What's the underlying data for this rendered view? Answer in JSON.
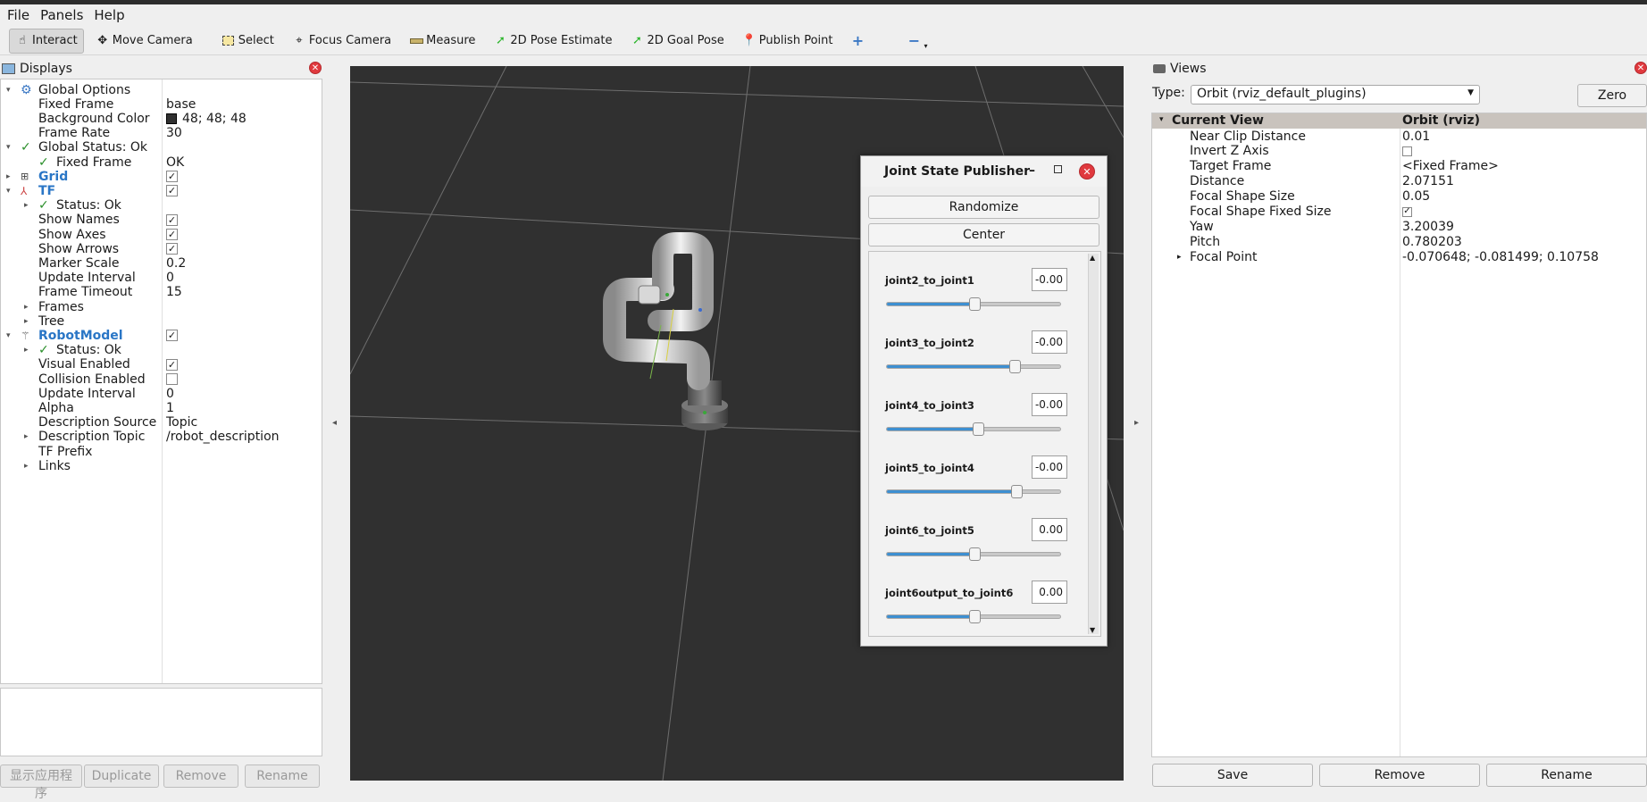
{
  "menu": [
    "File",
    "Panels",
    "Help"
  ],
  "toolbar": {
    "interact": "Interact",
    "move_camera": "Move Camera",
    "select": "Select",
    "focus_camera": "Focus Camera",
    "measure": "Measure",
    "pose_estimate": "2D Pose Estimate",
    "goal_pose": "2D Goal Pose",
    "publish_point": "Publish Point"
  },
  "displays": {
    "title": "Displays",
    "rows": [
      {
        "label": "Global Options",
        "value": ""
      },
      {
        "label": "Fixed Frame",
        "value": "base"
      },
      {
        "label": "Background Color",
        "value": "48; 48; 48"
      },
      {
        "label": "Frame Rate",
        "value": "30"
      },
      {
        "label": "Global Status: Ok",
        "value": ""
      },
      {
        "label": "Fixed Frame",
        "value": "OK"
      },
      {
        "label": "Grid",
        "value": ""
      },
      {
        "label": "TF",
        "value": ""
      },
      {
        "label": "Status: Ok",
        "value": ""
      },
      {
        "label": "Show Names",
        "value": ""
      },
      {
        "label": "Show Axes",
        "value": ""
      },
      {
        "label": "Show Arrows",
        "value": ""
      },
      {
        "label": "Marker Scale",
        "value": "0.2"
      },
      {
        "label": "Update Interval",
        "value": "0"
      },
      {
        "label": "Frame Timeout",
        "value": "15"
      },
      {
        "label": "Frames",
        "value": ""
      },
      {
        "label": "Tree",
        "value": ""
      },
      {
        "label": "RobotModel",
        "value": ""
      },
      {
        "label": "Status: Ok",
        "value": ""
      },
      {
        "label": "Visual Enabled",
        "value": ""
      },
      {
        "label": "Collision Enabled",
        "value": ""
      },
      {
        "label": "Update Interval",
        "value": "0"
      },
      {
        "label": "Alpha",
        "value": "1"
      },
      {
        "label": "Description Source",
        "value": "Topic"
      },
      {
        "label": "Description Topic",
        "value": "/robot_description"
      },
      {
        "label": "TF Prefix",
        "value": ""
      },
      {
        "label": "Links",
        "value": ""
      }
    ],
    "buttons": {
      "add": "显示应用程序",
      "duplicate": "Duplicate",
      "remove": "Remove",
      "rename": "Rename"
    }
  },
  "jsp": {
    "title": "Joint State Publisher",
    "randomize": "Randomize",
    "center": "Center",
    "joints": [
      {
        "name": "joint2_to_joint1",
        "value": "-0.00",
        "position": 0.5
      },
      {
        "name": "joint3_to_joint2",
        "value": "-0.00",
        "position": 0.73
      },
      {
        "name": "joint4_to_joint3",
        "value": "-0.00",
        "position": 0.52
      },
      {
        "name": "joint5_to_joint4",
        "value": "-0.00",
        "position": 0.74
      },
      {
        "name": "joint6_to_joint5",
        "value": "0.00",
        "position": 0.5
      },
      {
        "name": "joint6output_to_joint6",
        "value": "0.00",
        "position": 0.5
      }
    ]
  },
  "views": {
    "title": "Views",
    "type_label": "Type:",
    "type_value": "Orbit (rviz_default_plugins)",
    "zero": "Zero",
    "header_key": "Current View",
    "header_value": "Orbit (rviz)",
    "props": [
      {
        "key": "Near Clip Distance",
        "value": "0.01"
      },
      {
        "key": "Invert Z Axis",
        "value": ""
      },
      {
        "key": "Target Frame",
        "value": "<Fixed Frame>"
      },
      {
        "key": "Distance",
        "value": "2.07151"
      },
      {
        "key": "Focal Shape Size",
        "value": "0.05"
      },
      {
        "key": "Focal Shape Fixed Size",
        "value": ""
      },
      {
        "key": "Yaw",
        "value": "3.20039"
      },
      {
        "key": "Pitch",
        "value": "0.780203"
      },
      {
        "key": "Focal Point",
        "value": "-0.070648; -0.081499; 0.10758"
      }
    ],
    "buttons": {
      "save": "Save",
      "remove": "Remove",
      "rename": "Rename"
    }
  },
  "colors": {
    "viewport_bg": "#303030",
    "accent": "#3d8fd1",
    "close": "#e0393e"
  }
}
